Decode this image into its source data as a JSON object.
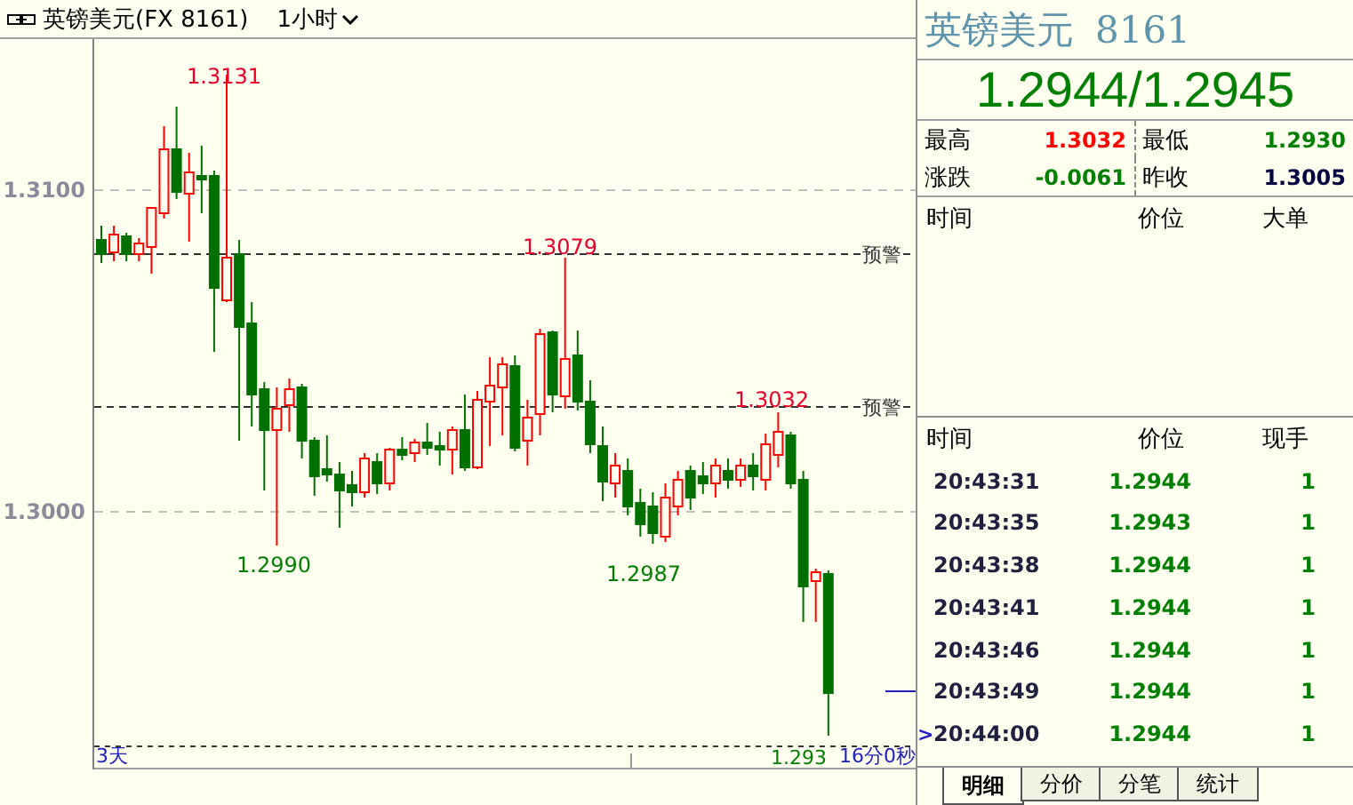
{
  "toolbar": {
    "symbol": "英镑美元(FX 8161)",
    "timeframe": "1小时"
  },
  "chart": {
    "y_labels": [
      "1.3100",
      "1.3000"
    ],
    "price_labels": [
      {
        "text": "1.3131",
        "kind": "high"
      },
      {
        "text": "1.3079",
        "kind": "high"
      },
      {
        "text": "1.3032",
        "kind": "high"
      },
      {
        "text": "1.2990",
        "kind": "low"
      },
      {
        "text": "1.2987",
        "kind": "low"
      }
    ],
    "alerts": [
      "预警",
      "预警"
    ],
    "span": "3天",
    "last_price": "1.293",
    "countdown": "16分0秒"
  },
  "quote": {
    "name": "英镑美元",
    "code": "8161",
    "price": "1.2944/1.2945",
    "stats": [
      {
        "label": "最高",
        "value": "1.3032",
        "color": "#ff0000"
      },
      {
        "label": "最低",
        "value": "1.2930",
        "color": "#008000"
      },
      {
        "label": "涨跌",
        "value": "-0.0061",
        "color": "#008000"
      },
      {
        "label": "昨收",
        "value": "1.3005",
        "color": "#000040"
      }
    ]
  },
  "big_orders": {
    "columns": [
      "时间",
      "价位",
      "大单"
    ]
  },
  "ticks": {
    "columns": [
      "时间",
      "价位",
      "现手"
    ],
    "rows": [
      {
        "time": "20:43:31",
        "price": "1.2944",
        "volume": "1"
      },
      {
        "time": "20:43:35",
        "price": "1.2943",
        "volume": "1"
      },
      {
        "time": "20:43:38",
        "price": "1.2944",
        "volume": "1"
      },
      {
        "time": "20:43:41",
        "price": "1.2944",
        "volume": "1"
      },
      {
        "time": "20:43:46",
        "price": "1.2944",
        "volume": "1"
      },
      {
        "time": "20:43:49",
        "price": "1.2944",
        "volume": "1"
      },
      {
        "time": "20:44:00",
        "price": "1.2944",
        "volume": "1",
        "marker": ">"
      }
    ]
  },
  "tabs": [
    {
      "label": "明细",
      "selected": true
    },
    {
      "label": "分价",
      "selected": false
    },
    {
      "label": "分笔",
      "selected": false
    },
    {
      "label": "统计",
      "selected": false
    }
  ]
}
